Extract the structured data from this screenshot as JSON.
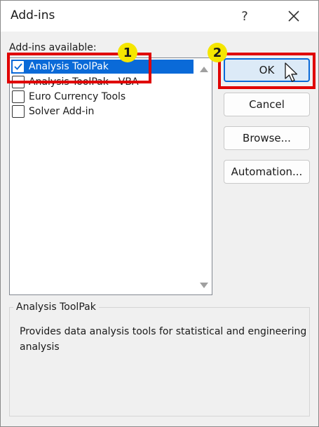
{
  "window": {
    "title": "Add-ins",
    "help_label": "?"
  },
  "addins_label": "Add-ins available:",
  "addins": [
    {
      "label": "Analysis ToolPak",
      "checked": true,
      "selected": true
    },
    {
      "label": "Analysis ToolPak - VBA",
      "checked": false,
      "selected": false
    },
    {
      "label": "Euro Currency Tools",
      "checked": false,
      "selected": false
    },
    {
      "label": "Solver Add-in",
      "checked": false,
      "selected": false
    }
  ],
  "buttons": {
    "ok": "OK",
    "cancel": "Cancel",
    "browse": "Browse...",
    "automation": "Automation..."
  },
  "description": {
    "title": "Analysis ToolPak",
    "text": "Provides data analysis tools for statistical and engineering analysis"
  },
  "annotations": {
    "step1": "1",
    "step2": "2",
    "box_color": "#e00000",
    "badge_color": "#f5e600"
  }
}
